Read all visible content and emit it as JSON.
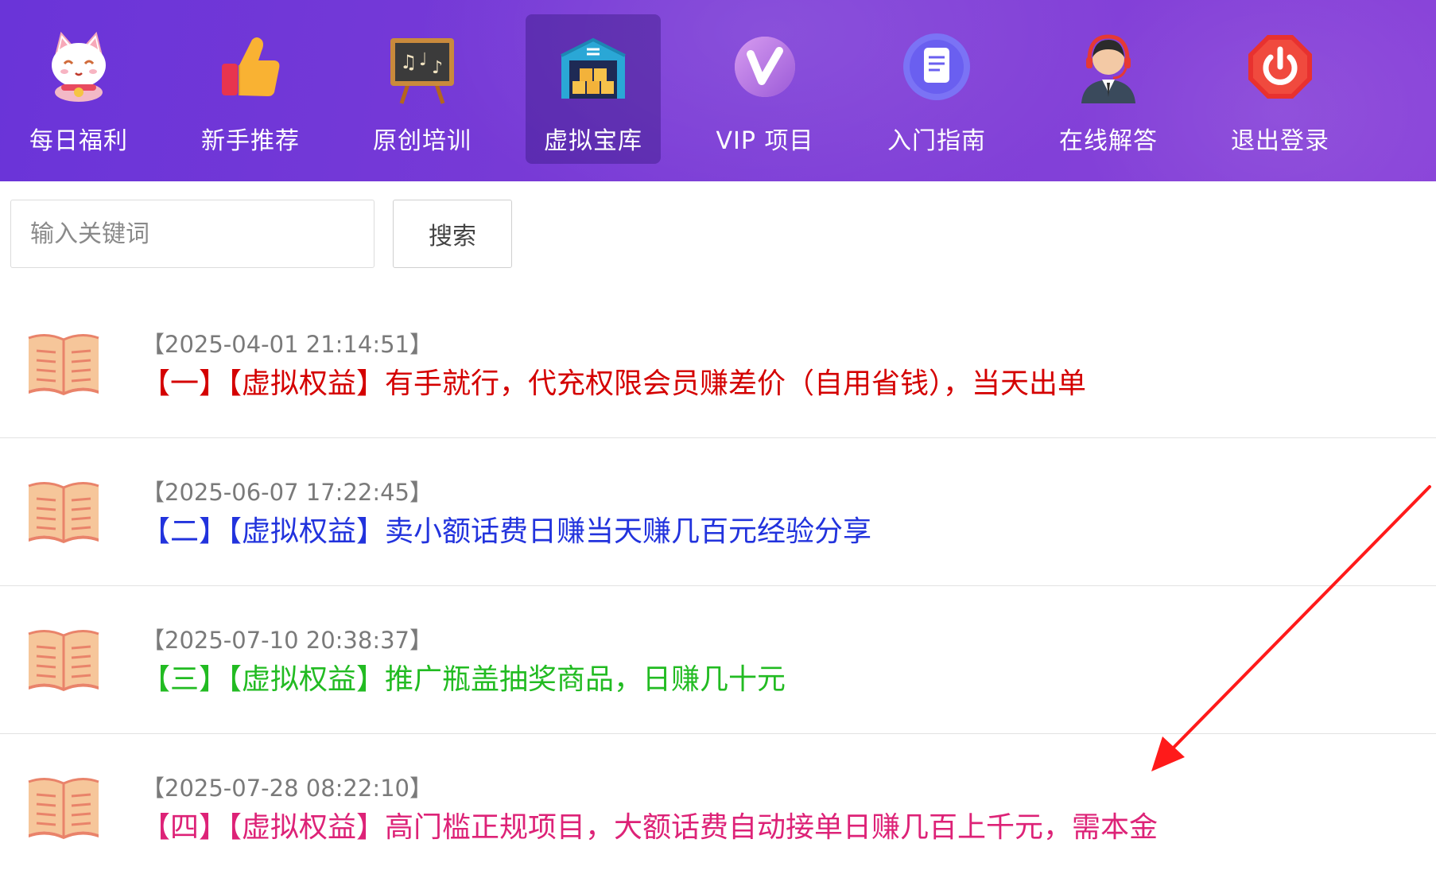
{
  "nav": {
    "items": [
      {
        "label": "每日福利",
        "icon": "lucky-cat-icon"
      },
      {
        "label": "新手推荐",
        "icon": "thumbs-up-icon"
      },
      {
        "label": "原创培训",
        "icon": "blackboard-icon"
      },
      {
        "label": "虚拟宝库",
        "icon": "warehouse-icon",
        "active": true
      },
      {
        "label": "VIP 项目",
        "icon": "vip-icon"
      },
      {
        "label": "入门指南",
        "icon": "guide-document-icon"
      },
      {
        "label": "在线解答",
        "icon": "customer-service-icon"
      },
      {
        "label": "退出登录",
        "icon": "power-icon"
      }
    ]
  },
  "search": {
    "placeholder": "输入关键词",
    "button_label": "搜索"
  },
  "articles": [
    {
      "date": "【2025-04-01 21:14:51】",
      "title": "【一】【虚拟权益】有手就行，代充权限会员赚差价（自用省钱），当天出单",
      "color": "#d40000"
    },
    {
      "date": "【2025-06-07 17:22:45】",
      "title": "【二】【虚拟权益】卖小额话费日赚当天赚几百元经验分享",
      "color": "#2233dd"
    },
    {
      "date": "【2025-07-10 20:38:37】",
      "title": "【三】【虚拟权益】推广瓶盖抽奖商品，日赚几十元",
      "color": "#22bb22"
    },
    {
      "date": "【2025-07-28 08:22:10】",
      "title": "【四】【虚拟权益】高门槛正规项目，大额话费自动接单日赚几百上千元，需本金",
      "color": "#dd2277"
    }
  ],
  "colors": {
    "nav_background": "#7238d6",
    "annotation_arrow": "#ff1a1a",
    "date_text": "#7a7a7a"
  }
}
